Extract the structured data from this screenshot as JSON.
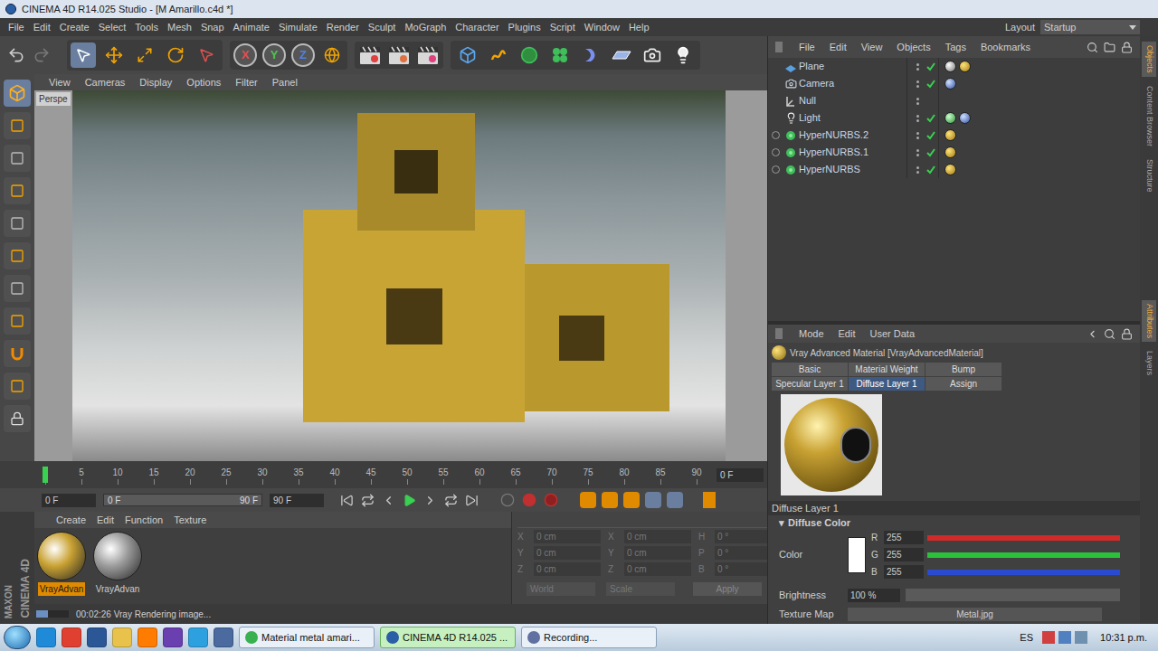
{
  "window": {
    "title": "CINEMA 4D R14.025 Studio - [M Amarillo.c4d *]"
  },
  "menu": [
    "File",
    "Edit",
    "Create",
    "Select",
    "Tools",
    "Mesh",
    "Snap",
    "Animate",
    "Simulate",
    "Render",
    "Sculpt",
    "MoGraph",
    "Character",
    "Plugins",
    "Script",
    "Window",
    "Help"
  ],
  "layout": {
    "label": "Layout",
    "value": "Startup"
  },
  "toolbar": {
    "axis_buttons": [
      "X",
      "Y",
      "Z"
    ]
  },
  "viewport": {
    "menu": [
      "View",
      "Cameras",
      "Display",
      "Options",
      "Filter",
      "Panel"
    ],
    "camera_label": "Perspe"
  },
  "timeline": {
    "ticks": [
      "0",
      "5",
      "10",
      "15",
      "20",
      "25",
      "30",
      "35",
      "40",
      "45",
      "50",
      "55",
      "60",
      "65",
      "70",
      "75",
      "80",
      "85",
      "90"
    ],
    "marker_level": 0,
    "current_frame": "0 F"
  },
  "playback": {
    "start_field": "0 F",
    "range_start": "0 F",
    "range_end": "90 F",
    "end_field": "90 F"
  },
  "material_manager": {
    "menu": [
      "Create",
      "Edit",
      "Function",
      "Texture"
    ],
    "materials": [
      {
        "name": "VrayAdvan",
        "selected": true,
        "color": "#c9a233"
      },
      {
        "name": "VrayAdvan",
        "selected": false,
        "color": "#9c9c9c"
      }
    ]
  },
  "coordinates": {
    "disabled": true,
    "rows": [
      {
        "axis": "X",
        "position": "0 cm",
        "size_axis": "X",
        "size": "0 cm",
        "rot_axis": "H",
        "rotation": "0 °"
      },
      {
        "axis": "Y",
        "position": "0 cm",
        "size_axis": "Y",
        "size": "0 cm",
        "rot_axis": "P",
        "rotation": "0 °"
      },
      {
        "axis": "Z",
        "position": "0 cm",
        "size_axis": "Z",
        "size": "0 cm",
        "rot_axis": "B",
        "rotation": "0 °"
      }
    ],
    "dropdowns": [
      "World",
      "Scale"
    ],
    "apply": "Apply"
  },
  "status_bar": {
    "text": "00:02:26 Vray Rendering image...",
    "level": 0.35
  },
  "logo": {
    "brand": "MAXON",
    "product": "CINEMA 4D"
  },
  "object_manager": {
    "menu": [
      "File",
      "Edit",
      "View",
      "Objects",
      "Tags",
      "Bookmarks"
    ],
    "objects": [
      {
        "name": "Plane",
        "kind": "plane",
        "expandable": false,
        "enabled": true,
        "tags": [
          "texture",
          "material"
        ]
      },
      {
        "name": "Camera",
        "kind": "camera",
        "expandable": false,
        "enabled": true,
        "tags": [
          "target"
        ]
      },
      {
        "name": "Null",
        "kind": "null",
        "expandable": false,
        "enabled": false,
        "tags": []
      },
      {
        "name": "Light",
        "kind": "light",
        "expandable": false,
        "enabled": true,
        "tags": [
          "vray",
          "target"
        ]
      },
      {
        "name": "HyperNURBS.2",
        "kind": "nurbs",
        "expandable": true,
        "enabled": true,
        "tags": [
          "material"
        ]
      },
      {
        "name": "HyperNURBS.1",
        "kind": "nurbs",
        "expandable": true,
        "enabled": true,
        "tags": [
          "material"
        ]
      },
      {
        "name": "HyperNURBS",
        "kind": "nurbs",
        "expandable": true,
        "enabled": true,
        "tags": [
          "material"
        ]
      }
    ]
  },
  "attribute_manager": {
    "menu": [
      "Mode",
      "Edit",
      "User Data"
    ],
    "title": "Vray Advanced Material [VrayAdvancedMaterial]",
    "tabs": [
      {
        "label": "Basic",
        "selected": false
      },
      {
        "label": "Material Weight",
        "selected": false
      },
      {
        "label": "Bump",
        "selected": false
      },
      {
        "label": "Specular Layer 1",
        "selected": false
      },
      {
        "label": "Diffuse Layer 1",
        "selected": true
      },
      {
        "label": "Assign",
        "selected": false
      }
    ],
    "section": "Diffuse Layer 1",
    "group": {
      "icon": "▾",
      "label": "Diffuse Color"
    },
    "color": {
      "label": "Color",
      "swatch": "#ffffff",
      "channels": [
        {
          "name": "R",
          "value": "255",
          "level": 1,
          "color": "#d02a2a"
        },
        {
          "name": "G",
          "value": "255",
          "level": 1,
          "color": "#2ac23a"
        },
        {
          "name": "B",
          "value": "255",
          "level": 1,
          "color": "#2a4ad0"
        }
      ]
    },
    "brightness": {
      "label": "Brightness",
      "value": "100 %",
      "level": 1
    },
    "texture_map": {
      "label": "Texture Map",
      "value": "Metal.jpg"
    }
  },
  "side_tabs": [
    {
      "label": "Objects",
      "selected": true
    },
    {
      "label": "Content Browser",
      "selected": false
    },
    {
      "label": "Structure",
      "selected": false
    },
    {
      "label": "Attributes",
      "selected": true
    },
    {
      "label": "Layers",
      "selected": false
    }
  ],
  "taskbar": {
    "tasks": [
      {
        "label": "Material metal amari...",
        "selected": false
      },
      {
        "label": "CINEMA 4D R14.025 ...",
        "selected": true
      },
      {
        "label": "Recording...",
        "selected": false
      }
    ],
    "language": "ES",
    "clock": "10:31 p.m."
  }
}
